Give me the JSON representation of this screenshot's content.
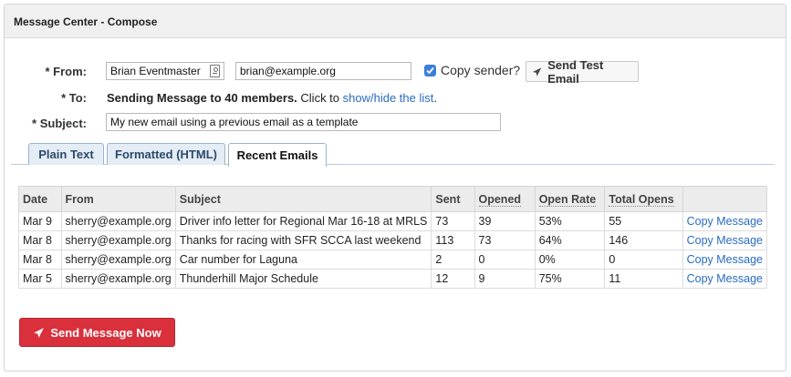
{
  "panel": {
    "title": "Message Center - Compose"
  },
  "form": {
    "from_label": "* From:",
    "from_name": "Brian Eventmaster",
    "from_email": "brian@example.org",
    "copy_sender_label": "Copy sender?",
    "copy_sender_checked": true,
    "send_test_label": "Send Test Email",
    "to_label": "* To:",
    "to_prefix": "Sending Message to 40 members.",
    "to_click": " Click to ",
    "to_link": "show/hide the list",
    "to_suffix": ".",
    "subject_label": "* Subject:",
    "subject_value": "My new email using a previous email as a template"
  },
  "tabs": [
    {
      "label": "Plain Text",
      "active": false
    },
    {
      "label": "Formatted (HTML)",
      "active": false
    },
    {
      "label": "Recent Emails",
      "active": true
    }
  ],
  "table": {
    "headers": [
      "Date",
      "From",
      "Subject",
      "Sent",
      "Opened",
      "Open Rate",
      "Total Opens",
      ""
    ],
    "rows": [
      {
        "date": "Mar 9",
        "from": "sherry@example.org",
        "subject": "Driver info letter for Regional Mar 16-18 at MRLS",
        "sent": "73",
        "opened": "39",
        "rate": "53%",
        "total": "55",
        "action": "Copy Message"
      },
      {
        "date": "Mar 8",
        "from": "sherry@example.org",
        "subject": "Thanks for racing with SFR SCCA last weekend",
        "sent": "113",
        "opened": "73",
        "rate": "64%",
        "total": "146",
        "action": "Copy Message"
      },
      {
        "date": "Mar 8",
        "from": "sherry@example.org",
        "subject": "Car number for Laguna",
        "sent": "2",
        "opened": "0",
        "rate": "0%",
        "total": "0",
        "action": "Copy Message"
      },
      {
        "date": "Mar 5",
        "from": "sherry@example.org",
        "subject": "Thunderhill Major Schedule",
        "sent": "12",
        "opened": "9",
        "rate": "75%",
        "total": "11",
        "action": "Copy Message"
      }
    ]
  },
  "actions": {
    "send_now_label": "Send Message Now"
  },
  "icons": {
    "send": "paper-plane-icon",
    "picker": "contact-card-icon",
    "check": "checkmark-icon"
  },
  "colors": {
    "primary_red": "#d9303c",
    "link_blue": "#2a6bc2",
    "checkbox_blue": "#3b7fd9"
  }
}
